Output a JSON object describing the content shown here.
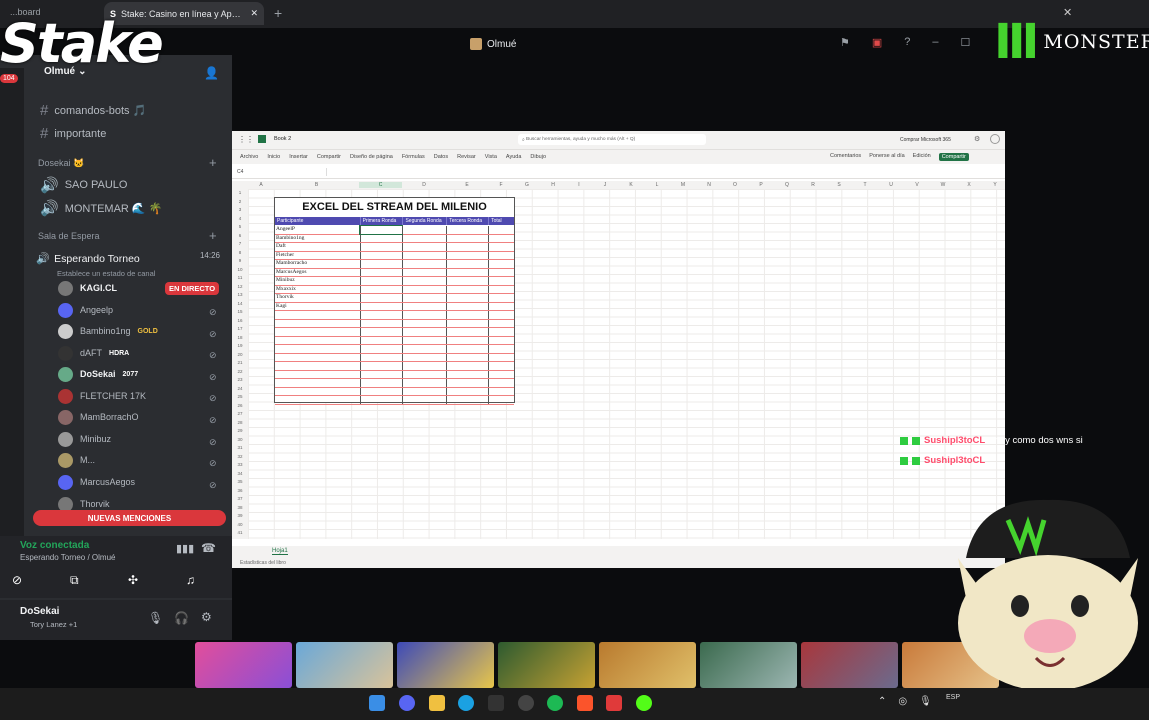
{
  "browser": {
    "tabs": [
      {
        "label": "...board"
      },
      {
        "label": "Stake: Casino en línea y Apuestas"
      }
    ],
    "new_tab": "+"
  },
  "overlay": {
    "brand_left": "Stake",
    "brand_right": "MONSTER"
  },
  "stream": {
    "title": "Olmué"
  },
  "discord": {
    "server_name": "Olmué",
    "channels_top": [
      {
        "label": "comandos-bots 🎵"
      },
      {
        "label": "importante"
      }
    ],
    "categories": {
      "dosekai": "Dosekai 🐱",
      "waiting": "Sala de Espera"
    },
    "dosekai_channels": [
      {
        "label": "SAO PAULO"
      },
      {
        "label": "MONTEMAR 🌊 🌴"
      }
    ],
    "voice_channel": {
      "name": "Esperando Torneo",
      "time": "14:26",
      "status": "Establece un estado de canal"
    },
    "voice_users": [
      {
        "name": "KAGI.CL",
        "tag": "EN DIRECTO"
      },
      {
        "name": "Angeelp",
        "tag": ""
      },
      {
        "name": "Bambino1ng",
        "tag": "GOLD"
      },
      {
        "name": "dAFT",
        "tag": "HDRA"
      },
      {
        "name": "DoSekai",
        "tag": "2077"
      },
      {
        "name": "FLETCHER 17K",
        "tag": ""
      },
      {
        "name": "MamBorrachO",
        "tag": ""
      },
      {
        "name": "Minibuz",
        "tag": ""
      },
      {
        "name": "M...",
        "tag": ""
      },
      {
        "name": "MarcusAegos",
        "tag": ""
      },
      {
        "name": "Thorvik",
        "tag": ""
      }
    ],
    "new_mentions": "NUEVAS MENCIONES",
    "voice_connected": "Voz conectada",
    "voice_location": "Esperando Torneo / Olmué",
    "user": {
      "name": "DoSekai",
      "status": "Tory Lanez +1"
    },
    "unread_badge": "104"
  },
  "excel": {
    "file": "Book 2",
    "search_placeholder": "Buscar herramientas, ayuda y mucho más (Alt + Q)",
    "buy": "Comprar Microsoft 365",
    "menu": [
      "Archivo",
      "Inicio",
      "Insertar",
      "Compartir",
      "Diseño de página",
      "Fórmulas",
      "Datos",
      "Revisar",
      "Vista",
      "Ayuda",
      "Dibujo"
    ],
    "right_actions": [
      "Comentarios",
      "Ponerse al día",
      "Edición",
      "Compartir"
    ],
    "cell_ref": "C4",
    "columns": [
      "A",
      "B",
      "C",
      "D",
      "E",
      "F",
      "G",
      "H",
      "I",
      "J",
      "K",
      "L",
      "M",
      "N",
      "O",
      "P",
      "Q",
      "R",
      "S",
      "T",
      "U",
      "V",
      "W",
      "X",
      "Y"
    ],
    "table_title": "EXCEL DEL STREAM DEL MILENIO",
    "table_headers": [
      "Participante",
      "Primera Ronda",
      "Segunda Ronda",
      "Tercera Ronda",
      "Total"
    ],
    "participants": [
      "AngeelP",
      "Bambino1ng",
      "Daft",
      "Fletcher",
      "Mamborracho",
      "MarcusAegos",
      "Minibuz",
      "Mxaxxix",
      "Thorvik",
      "Kagi"
    ],
    "sheet_tab": "Hoja1",
    "status": "Estadísticas del libro"
  },
  "chat": [
    {
      "user": "Sushipl3toCL",
      "msg": ": hay como dos wns si"
    },
    {
      "user": "Sushipl3toCL",
      "msg": ":"
    }
  ],
  "taskbar": {
    "lang": "ESP"
  }
}
